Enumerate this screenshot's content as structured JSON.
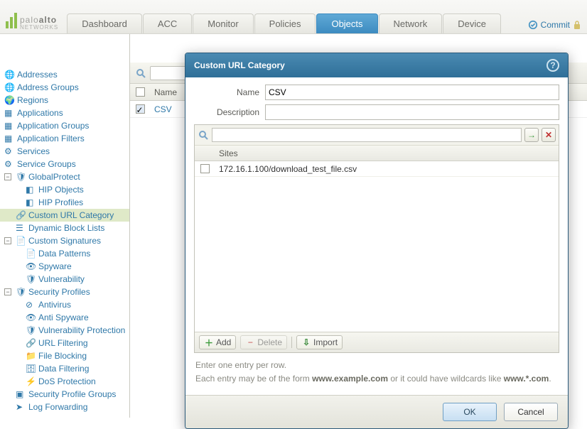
{
  "brand": {
    "name_light": "palo",
    "name_bold": "alto",
    "sub": "NETWORKS"
  },
  "header": {
    "tabs": [
      "Dashboard",
      "ACC",
      "Monitor",
      "Policies",
      "Objects",
      "Network",
      "Device"
    ],
    "active_tab": "Objects",
    "commit": "Commit"
  },
  "tree": {
    "items": [
      {
        "label": "Addresses",
        "icon": "globe"
      },
      {
        "label": "Address Groups",
        "icon": "globes"
      },
      {
        "label": "Regions",
        "icon": "globe-blue"
      },
      {
        "label": "Applications",
        "icon": "apps"
      },
      {
        "label": "Application Groups",
        "icon": "apps"
      },
      {
        "label": "Application Filters",
        "icon": "apps"
      },
      {
        "label": "Services",
        "icon": "gear"
      },
      {
        "label": "Service Groups",
        "icon": "gears"
      }
    ],
    "gp": {
      "label": "GlobalProtect",
      "children": [
        {
          "label": "HIP Objects",
          "icon": "hip"
        },
        {
          "label": "HIP Profiles",
          "icon": "hip"
        }
      ]
    },
    "custom_url": {
      "label": "Custom URL Category",
      "icon": "url",
      "selected": true
    },
    "dbl": {
      "label": "Dynamic Block Lists",
      "icon": "list"
    },
    "custom_sig": {
      "label": "Custom Signatures",
      "children": [
        {
          "label": "Data Patterns",
          "icon": "doc"
        },
        {
          "label": "Spyware",
          "icon": "spy"
        },
        {
          "label": "Vulnerability",
          "icon": "shield"
        }
      ]
    },
    "sec_profiles": {
      "label": "Security Profiles",
      "children": [
        {
          "label": "Antivirus",
          "icon": "av"
        },
        {
          "label": "Anti Spyware",
          "icon": "spy"
        },
        {
          "label": "Vulnerability Protection",
          "icon": "shield"
        },
        {
          "label": "URL Filtering",
          "icon": "url"
        },
        {
          "label": "File Blocking",
          "icon": "file"
        },
        {
          "label": "Data Filtering",
          "icon": "data"
        },
        {
          "label": "DoS Protection",
          "icon": "dos"
        }
      ]
    },
    "spg": {
      "label": "Security Profile Groups",
      "icon": "group"
    },
    "log_fwd": {
      "label": "Log Forwarding",
      "icon": "log"
    }
  },
  "grid": {
    "columns": [
      "",
      "Name"
    ],
    "rows": [
      {
        "name": "CSV",
        "checked": true
      }
    ]
  },
  "dialog": {
    "title": "Custom URL Category",
    "fields": {
      "name_label": "Name",
      "name_value": "CSV",
      "desc_label": "Description",
      "desc_value": ""
    },
    "sites": {
      "header": "Sites",
      "rows": [
        "172.16.1.100/download_test_file.csv"
      ],
      "toolbar": {
        "add": "Add",
        "delete": "Delete",
        "import": "Import"
      },
      "hint_line1": "Enter one entry per row.",
      "hint_line2a": "Each entry may be of the form ",
      "hint_bold1": "www.example.com",
      "hint_line2b": " or it could have wildcards like ",
      "hint_bold2": "www.*.com",
      "hint_line2c": "."
    },
    "buttons": {
      "ok": "OK",
      "cancel": "Cancel"
    }
  }
}
